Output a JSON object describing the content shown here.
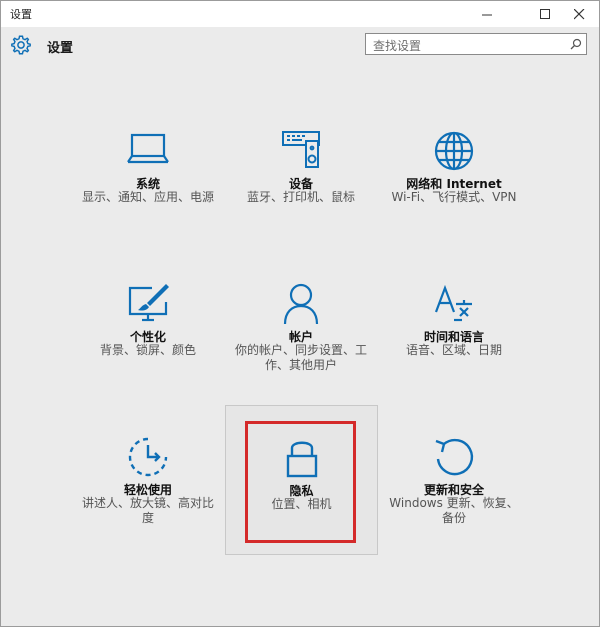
{
  "window": {
    "title": "设置"
  },
  "header": {
    "title": "设置"
  },
  "search": {
    "placeholder": "查找设置"
  },
  "colors": {
    "accent": "#0f6fb6",
    "highlight": "#d42a2a"
  },
  "tiles": [
    {
      "name": "系统",
      "desc": "显示、通知、应用、电源",
      "icon": "laptop-icon"
    },
    {
      "name": "设备",
      "desc": "蓝牙、打印机、鼠标",
      "icon": "devices-icon"
    },
    {
      "name": "网络和 Internet",
      "desc": "Wi-Fi、飞行模式、VPN",
      "icon": "globe-icon"
    },
    {
      "name": "个性化",
      "desc": "背景、锁屏、颜色",
      "icon": "personalization-icon"
    },
    {
      "name": "帐户",
      "desc": "你的帐户、同步设置、工作、其他用户",
      "icon": "person-icon"
    },
    {
      "name": "时间和语言",
      "desc": "语音、区域、日期",
      "icon": "time-language-icon"
    },
    {
      "name": "轻松使用",
      "desc": "讲述人、放大镜、高对比度",
      "icon": "ease-of-access-icon"
    },
    {
      "name": "隐私",
      "desc": "位置、相机",
      "icon": "lock-icon"
    },
    {
      "name": "更新和安全",
      "desc": "Windows 更新、恢复、备份",
      "icon": "update-icon"
    }
  ]
}
